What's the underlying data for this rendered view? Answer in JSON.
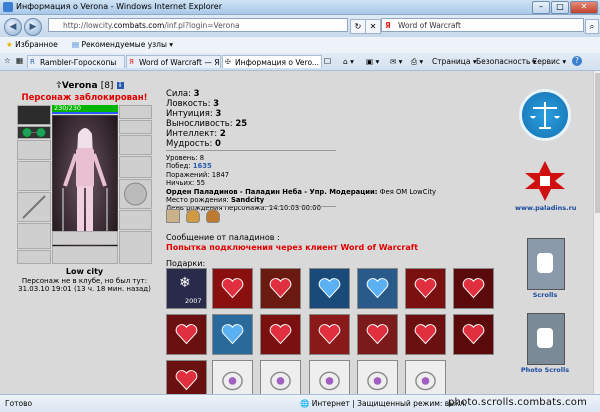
{
  "window": {
    "title": "Информация о Verona - Windows Internet Explorer",
    "controls": [
      "–",
      "□",
      "✕"
    ]
  },
  "address_bar": {
    "url_prefix": "http://lowcity.",
    "url_domain": "combats.com",
    "url_suffix": "/inf.pl?login=Verona",
    "search_text": "Word of Warcraft",
    "search_engine": "Я"
  },
  "favorites_bar": {
    "favorites_label": "Избранное",
    "recommended_label": "Рекомендуемые узлы ▾"
  },
  "tabs": [
    {
      "label": "Rambler-Гороскопы"
    },
    {
      "label": "Word of Warcraft — Ян..."
    },
    {
      "label": "Информация о Vero..."
    }
  ],
  "command_bar": {
    "page": "Страница ▾",
    "safety": "Безопасность ▾",
    "service": "Сервис ▾",
    "help": "?"
  },
  "character": {
    "name": "Verona",
    "level": "[8]",
    "badge": "i",
    "blocked_text": "Персонаж заблокирован!",
    "hp": "230/230",
    "city": "Low city",
    "note_line1": "Персонаж не в клубе, но был тут:",
    "note_line2": "31.03.10 19:01 (13 ч. 18 мин. назад)"
  },
  "stats": {
    "strength_label": "Сила:",
    "strength": "3",
    "agility_label": "Ловкость:",
    "agility": "3",
    "intuition_label": "Интуиция:",
    "intuition": "3",
    "endurance_label": "Выносливость:",
    "endurance": "25",
    "intellect_label": "Интеллект:",
    "intellect": "2",
    "wisdom_label": "Мудрость:",
    "wisdom": "0"
  },
  "details": {
    "level_label": "Уровень:",
    "level": "8",
    "wins_label": "Побед:",
    "wins": "1635",
    "losses_label": "Поражений:",
    "losses": "1847",
    "draws_label": "Ничьих:",
    "draws": "55",
    "order": "Орден Паладинов - Паладин Неба - Упр. Модерации:",
    "order_rest": "Фея ОМ LowCity",
    "birthplace_label": "Место рождения:",
    "birthplace": "Sandcity",
    "birthday_label": "День рождения персонажа:",
    "birthday": "14.10.03 00:00"
  },
  "paladin_message": {
    "heading": "Сообщение от паладинов :",
    "text": "Попытка подключения через клиент Word of Warcraft"
  },
  "gifts": {
    "label": "Подарки:",
    "first_caption": "2007"
  },
  "right_column": {
    "paladins_link": "www.paladins.ru",
    "scrolls": "Scrolls",
    "photo_scrolls": "Photo Scrolls"
  },
  "status_bar": {
    "left": "Готово",
    "zone": "Интернет | Защищенный режим: выкл.",
    "watermark": "photo.scrolls.combats.com"
  },
  "colors": {
    "blocked_red": "#e00000",
    "hp_green": "#00b400",
    "link_blue": "#2a5aaa",
    "content_gray": "#d9d9d9"
  }
}
